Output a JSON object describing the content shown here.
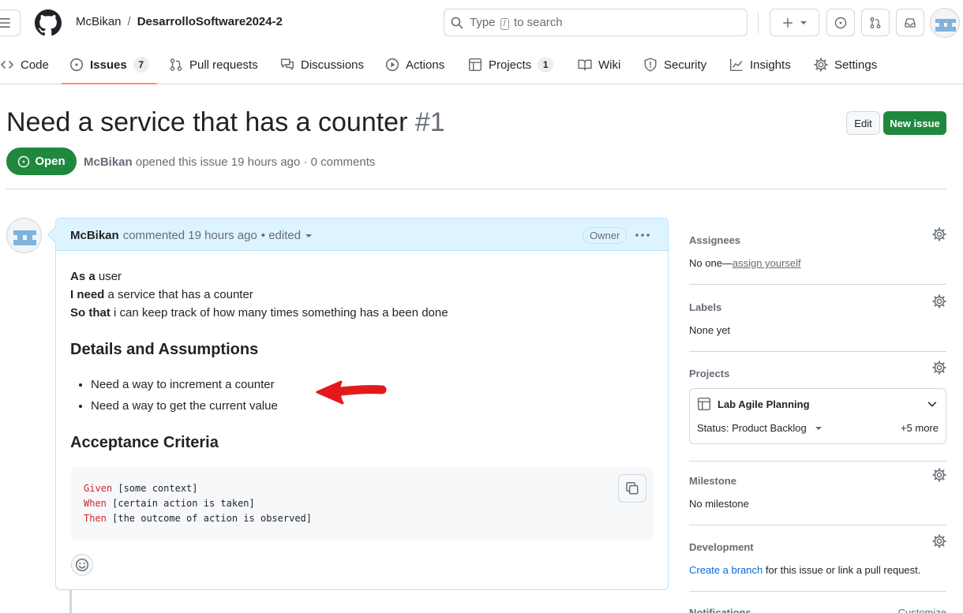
{
  "header": {
    "owner": "McBikan",
    "separator": "/",
    "repo": "DesarrolloSoftware2024-2",
    "search": {
      "prefix": "Type",
      "key": "/",
      "suffix": "to search"
    }
  },
  "nav": {
    "tabs": [
      {
        "label": "Code",
        "icon": "code-icon"
      },
      {
        "label": "Issues",
        "count": "7",
        "icon": "issue-icon"
      },
      {
        "label": "Pull requests",
        "icon": "pull-request-icon"
      },
      {
        "label": "Discussions",
        "icon": "discussion-icon"
      },
      {
        "label": "Actions",
        "icon": "play-icon"
      },
      {
        "label": "Projects",
        "count": "1",
        "icon": "table-icon"
      },
      {
        "label": "Wiki",
        "icon": "book-icon"
      },
      {
        "label": "Security",
        "icon": "shield-icon"
      },
      {
        "label": "Insights",
        "icon": "graph-icon"
      },
      {
        "label": "Settings",
        "icon": "gear-icon"
      }
    ]
  },
  "issue": {
    "title": "Need a service that has a counter",
    "number": "#1",
    "edit_label": "Edit",
    "new_issue_label": "New issue",
    "state": "Open",
    "author": "McBikan",
    "meta_text": "opened this issue 19 hours ago · 0 comments"
  },
  "comment": {
    "author": "McBikan",
    "header_text": "commented 19 hours ago",
    "edited": "• edited",
    "badge": "Owner",
    "story": [
      {
        "strong": "As a",
        "rest": " user"
      },
      {
        "strong": "I need",
        "rest": " a service that has a counter"
      },
      {
        "strong": "So that",
        "rest": " i can keep track of how many times something has a been done"
      }
    ],
    "details_heading": "Details and Assumptions",
    "details": [
      "Need a way to increment a counter",
      "Need a way to get the current value"
    ],
    "criteria_heading": "Acceptance Criteria",
    "code": [
      {
        "kw": "Given",
        "rest": " [some context]"
      },
      {
        "kw": "When",
        "rest": " [certain action is taken]"
      },
      {
        "kw": "Then",
        "rest": " [the outcome of action is observed]"
      }
    ]
  },
  "sidebar": {
    "assignees": {
      "title": "Assignees",
      "text": "No one—",
      "link": "assign yourself"
    },
    "labels": {
      "title": "Labels",
      "text": "None yet"
    },
    "projects": {
      "title": "Projects",
      "project_name": "Lab Agile Planning",
      "status": "Status: Product Backlog",
      "more": "+5 more"
    },
    "milestone": {
      "title": "Milestone",
      "text": "No milestone"
    },
    "development": {
      "title": "Development",
      "link": "Create a branch",
      "text": " for this issue or link a pull request."
    },
    "notifications": {
      "title": "Notifications",
      "action": "Customize"
    }
  },
  "colors": {
    "accent_green": "#1f883d",
    "tab_underline": "#fd8c73",
    "comment_header": "#ddf4ff",
    "annotation_arrow": "#e3191c"
  }
}
